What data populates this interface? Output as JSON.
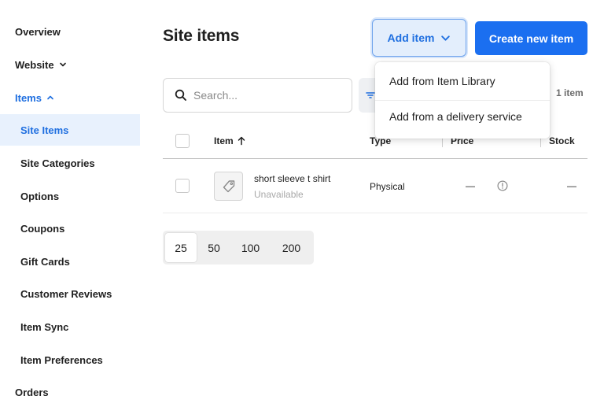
{
  "sidebar": {
    "items": [
      {
        "label": "Overview"
      },
      {
        "label": "Website",
        "icon": "chevron-down-icon"
      },
      {
        "label": "Items",
        "icon": "chevron-up-icon"
      },
      {
        "label": "Site Items"
      },
      {
        "label": "Site Categories"
      },
      {
        "label": "Options"
      },
      {
        "label": "Coupons"
      },
      {
        "label": "Gift Cards"
      },
      {
        "label": "Customer Reviews"
      },
      {
        "label": "Item Sync"
      },
      {
        "label": "Item Preferences"
      },
      {
        "label": "Orders"
      }
    ],
    "selected": "Site Items"
  },
  "header": {
    "title": "Site items",
    "add_item_label": "Add item",
    "create_label": "Create new item"
  },
  "add_menu": {
    "items": [
      {
        "label": "Add from Item Library"
      },
      {
        "label": "Add from a delivery service"
      }
    ]
  },
  "search": {
    "placeholder": "Search...",
    "value": ""
  },
  "results_count": "1 item",
  "table": {
    "columns": {
      "item": "Item",
      "type": "Type",
      "price": "Price",
      "stock": "Stock"
    },
    "sort": "Item ascending",
    "rows": [
      {
        "name": "short sleeve t shirt",
        "status": "Unavailable",
        "type": "Physical",
        "price": "—",
        "stock": "—"
      }
    ]
  },
  "pagination": {
    "options": [
      "25",
      "50",
      "100",
      "200"
    ],
    "selected": "25"
  },
  "colors": {
    "accent": "#1b6ff0",
    "selected_bg": "#e8f1fd",
    "muted_text": "#a8a8a8"
  }
}
